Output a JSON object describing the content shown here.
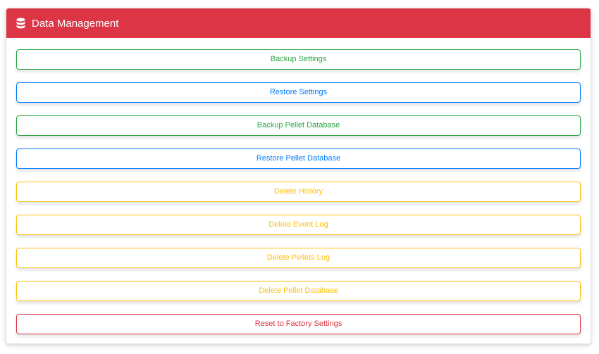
{
  "card": {
    "title": "Data Management",
    "icon": "database-icon",
    "header_color": "#dc3545"
  },
  "buttons": [
    {
      "label": "Backup Settings",
      "style": "success",
      "color": "#28a745"
    },
    {
      "label": "Restore Settings",
      "style": "primary",
      "color": "#007bff"
    },
    {
      "label": "Backup Pellet Database",
      "style": "success",
      "color": "#28a745"
    },
    {
      "label": "Restore Pellet Database",
      "style": "primary",
      "color": "#007bff"
    },
    {
      "label": "Delete History",
      "style": "warning",
      "color": "#ffc107"
    },
    {
      "label": "Delete Event Log",
      "style": "warning",
      "color": "#ffc107"
    },
    {
      "label": "Delete Pellets Log",
      "style": "warning",
      "color": "#ffc107"
    },
    {
      "label": "Delete Pellet Database",
      "style": "warning",
      "color": "#ffc107"
    },
    {
      "label": "Reset to Factory Settings",
      "style": "danger",
      "color": "#dc3545"
    }
  ]
}
